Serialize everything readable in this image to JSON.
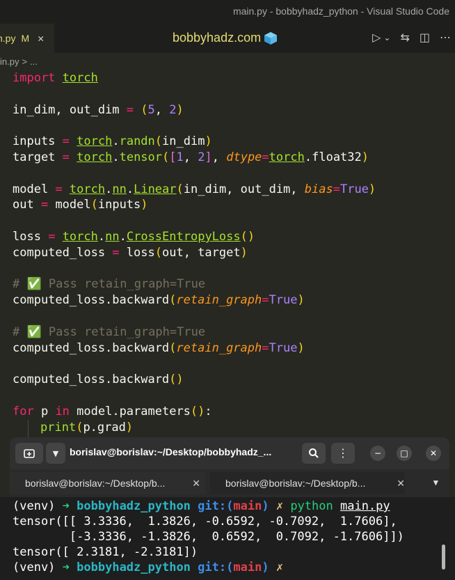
{
  "window": {
    "title": "main.py - bobbyhadz_python - Visual Studio Code"
  },
  "tabs": {
    "active_name": "n.py",
    "active_modified": "M",
    "close_glyph": "✕"
  },
  "header": {
    "site": "bobbyhadz.com"
  },
  "editor_actions": {
    "run": "▷",
    "run_menu": "⌄",
    "compare": "⇆",
    "split": "◫",
    "more": "⋯"
  },
  "breadcrumb": {
    "file": "in.py",
    "sep": ">",
    "rest": "..."
  },
  "code": {
    "l1_kw": "import",
    "l1_mod": "torch",
    "l2": "in_dim, out_dim ",
    "l2_op": "=",
    "l2_open": "(",
    "l2_a": "5",
    "l2_comma": ", ",
    "l2_b": "2",
    "l2_close": ")",
    "l3_var": "inputs ",
    "l3_op": "=",
    "l3_mod": "torch",
    "l3_fn": "randn",
    "l3_args": "in_dim",
    "l4_var": "target ",
    "l4_op": "=",
    "l4_mod": "torch",
    "l4_fn": "tensor",
    "l4_a": "1",
    "l4_b": "2",
    "l4_param": "dtype",
    "l4_mod2": "torch",
    "l4_attr": "float32",
    "l5_var": "model ",
    "l5_op": "=",
    "l5_mod": "torch",
    "l5_mod2": "nn",
    "l5_fn": "Linear",
    "l5_args": "in_dim, out_dim, ",
    "l5_param": "bias",
    "l5_const": "True",
    "l6_var": "out ",
    "l6_op": "=",
    "l6_rest": " model",
    "l6_args": "inputs",
    "l7_var": "loss ",
    "l7_op": "=",
    "l7_mod": "torch",
    "l7_mod2": "nn",
    "l7_fn": "CrossEntropyLoss",
    "l8_var": "computed_loss ",
    "l8_op": "=",
    "l8_rest": " loss",
    "l8_args": "out, target",
    "c1": "# ✅ Pass retain_graph=True",
    "l9_call": "computed_loss.backward",
    "l9_param": "retain_graph",
    "l9_const": "True",
    "c2": "# ✅ Pass retain_graph=True",
    "l10_call": "computed_loss.backward",
    "l10_param": "retain_graph",
    "l10_const": "True",
    "l11_call": "computed_loss.backward",
    "l12_kw": "for",
    "l12_var": " p ",
    "l12_kw2": "in",
    "l12_rest": " model.parameters",
    "l12_colon": ":",
    "l13_fn": "print",
    "l13_args": "p.grad"
  },
  "terminal": {
    "title": "borislav@borislav:~/Desktop/bobbyhadz_...",
    "new_tab_icon": "new-tab-icon",
    "tab1": "borislav@borislav:~/Desktop/b...",
    "tab2": "borislav@borislav:~/Desktop/b...",
    "tab_close": "✕",
    "prompt_venv": "(venv) ",
    "prompt_arrow": "➜",
    "prompt_dir": "bobbyhadz_python",
    "prompt_git": "git:(",
    "prompt_branch": "main",
    "prompt_git_close": ")",
    "prompt_dirty": "✗",
    "cmd": "python",
    "cmd_arg": "main.py",
    "out1": "tensor([[ 3.3336,  1.3826, -0.6592, -0.7092,  1.7606],",
    "out2": "        [-3.3336, -1.3826,  0.6592,  0.7092, -1.7606]])",
    "out3": "tensor([ 2.3181, -2.3181])"
  },
  "colors": {
    "editor_bg": "#272822",
    "keyword": "#f92672",
    "function": "#a6e22e",
    "number": "#ae81ff",
    "param": "#fd971f",
    "comment": "#75715e",
    "terminal_bg": "#1e1e1e"
  }
}
